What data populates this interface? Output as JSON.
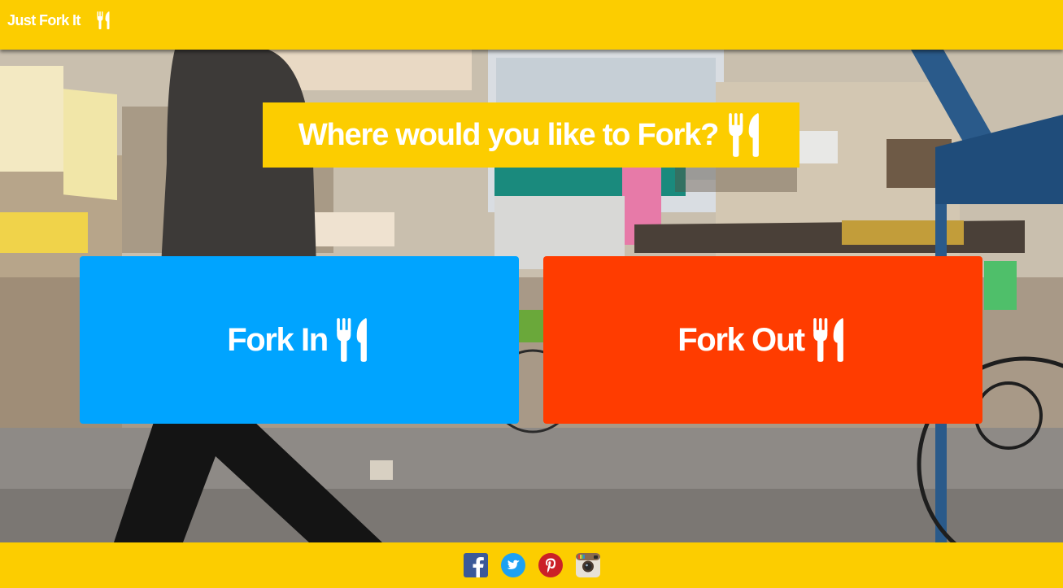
{
  "brand": {
    "name": "Just Fork It",
    "icon": "fork-knife-icon"
  },
  "hero": {
    "question": "Where would you like to Fork?",
    "question_icon": "fork-knife-icon"
  },
  "choices": [
    {
      "label": "Fork In",
      "icon": "fork-knife-icon",
      "color": "#00a4ff"
    },
    {
      "label": "Fork Out",
      "icon": "fork-knife-icon",
      "color": "#ff3c00"
    }
  ],
  "footer": {
    "social": [
      {
        "name": "facebook",
        "icon": "facebook-icon",
        "color": "#3b5998"
      },
      {
        "name": "twitter",
        "icon": "twitter-icon",
        "color": "#1da1f2"
      },
      {
        "name": "pinterest",
        "icon": "pinterest-icon",
        "color": "#cb2027"
      },
      {
        "name": "instagram",
        "icon": "instagram-icon",
        "color": "#8a6a4f"
      }
    ]
  },
  "colors": {
    "accent": "#fccd00",
    "text": "#ffffff"
  }
}
